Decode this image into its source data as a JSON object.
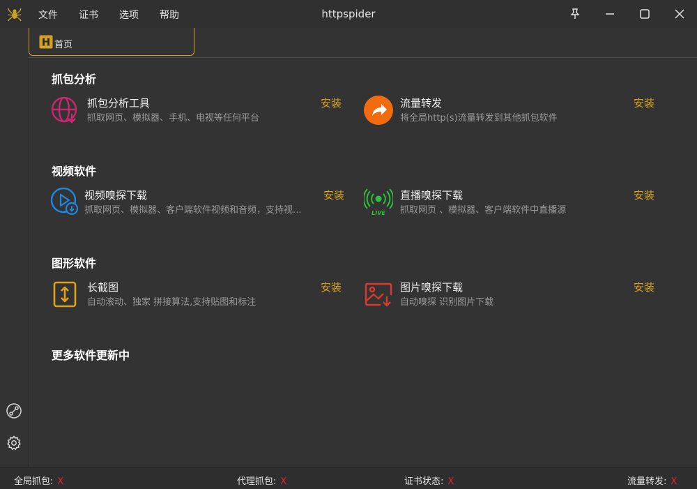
{
  "app": {
    "title": "httpspider"
  },
  "menu": {
    "file": "文件",
    "cert": "证书",
    "options": "选项",
    "help": "帮助"
  },
  "tab": {
    "home": "首页",
    "home_icon_letter": "H"
  },
  "sections": {
    "capture": {
      "title": "抓包分析",
      "left": {
        "title": "抓包分析工具",
        "desc": "抓取网页、模拟器、手机、电视等任何平台",
        "action": "安装",
        "icon": "globe-download-icon",
        "color": "#c8286e"
      },
      "right": {
        "title": "流量转发",
        "desc": "将全局http(s)流量转发到其他抓包软件",
        "action": "安装",
        "icon": "forward-arrow-icon",
        "color": "#f26b0f"
      }
    },
    "video": {
      "title": "视频软件",
      "left": {
        "title": "视频嗅探下载",
        "desc": "抓取网页、模拟器、客户端软件视频和音频，支持视...",
        "action": "安装",
        "icon": "video-download-icon",
        "color": "#1e88e5"
      },
      "right": {
        "title": "直播嗅探下载",
        "desc": "抓取网页 、模拟器、客户端软件中直播源",
        "action": "安装",
        "icon": "live-broadcast-icon",
        "color": "#2fbf3b",
        "badge": "LIVE"
      }
    },
    "graphics": {
      "title": "图形软件",
      "left": {
        "title": "长截图",
        "desc": "自动滚动、独家 拼接算法,支持贴图和标注",
        "action": "安装",
        "icon": "long-screenshot-icon",
        "color": "#e0a21a"
      },
      "right": {
        "title": "图片嗅探下载",
        "desc": "自动嗅探 识别图片下载",
        "action": "安装",
        "icon": "image-download-icon",
        "color": "#d83a2c"
      }
    },
    "more": {
      "title": "更多软件更新中"
    }
  },
  "status": {
    "global_capture": {
      "label": "全局抓包:",
      "value": "X"
    },
    "proxy_capture": {
      "label": "代理抓包:",
      "value": "X"
    },
    "cert_status": {
      "label": "证书状态:",
      "value": "X"
    },
    "traffic_forward": {
      "label": "流量转发:",
      "value": "X"
    }
  },
  "colors": {
    "accent": "#d4a123",
    "error": "#e02828"
  }
}
